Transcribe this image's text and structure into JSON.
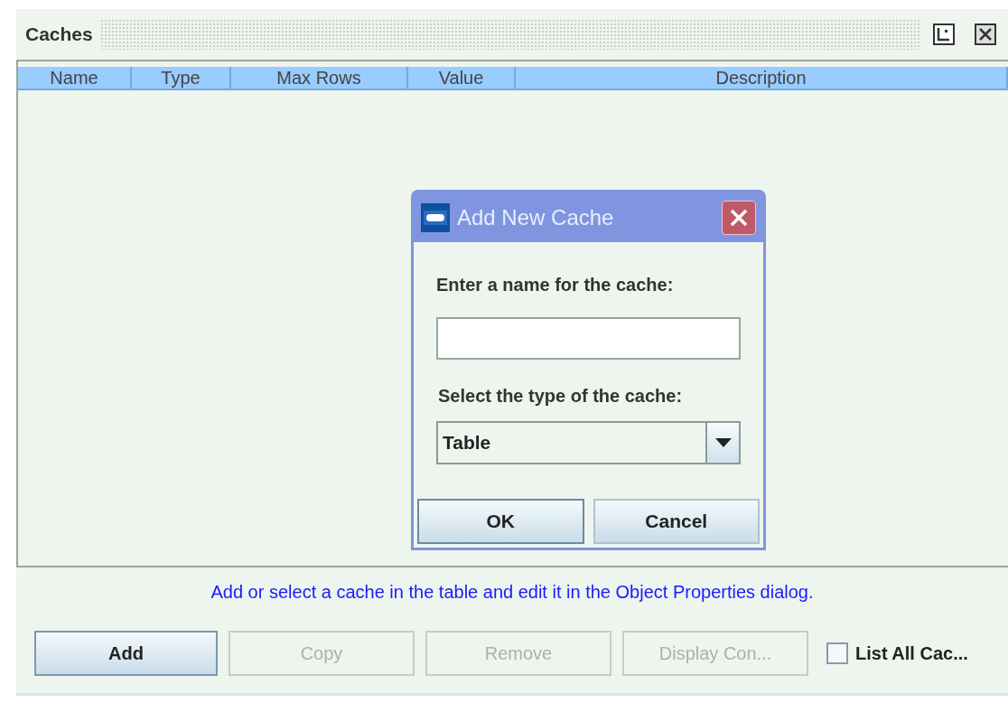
{
  "panel": {
    "title": "Caches"
  },
  "table": {
    "columns": [
      "Name",
      "Type",
      "Max Rows",
      "Value",
      "Description"
    ]
  },
  "dialog": {
    "title": "Add New Cache",
    "name_label": "Enter a name for the cache:",
    "type_label": "Select the type of the cache:",
    "type_value": "Table",
    "buttons": [
      {
        "label": "OK",
        "focused": true
      },
      {
        "label": "Cancel",
        "focused": false
      }
    ]
  },
  "hint": "Add or select a cache in the table and edit it in the Object Properties dialog.",
  "buttons": [
    {
      "label": "Add",
      "disabled": false,
      "focused": true
    },
    {
      "label": "Copy",
      "disabled": true,
      "focused": false
    },
    {
      "label": "Remove",
      "disabled": true,
      "focused": false
    },
    {
      "label": "Display Con...",
      "disabled": true,
      "focused": false
    }
  ],
  "list_all": {
    "label": "List All Cac...",
    "checked": false
  }
}
